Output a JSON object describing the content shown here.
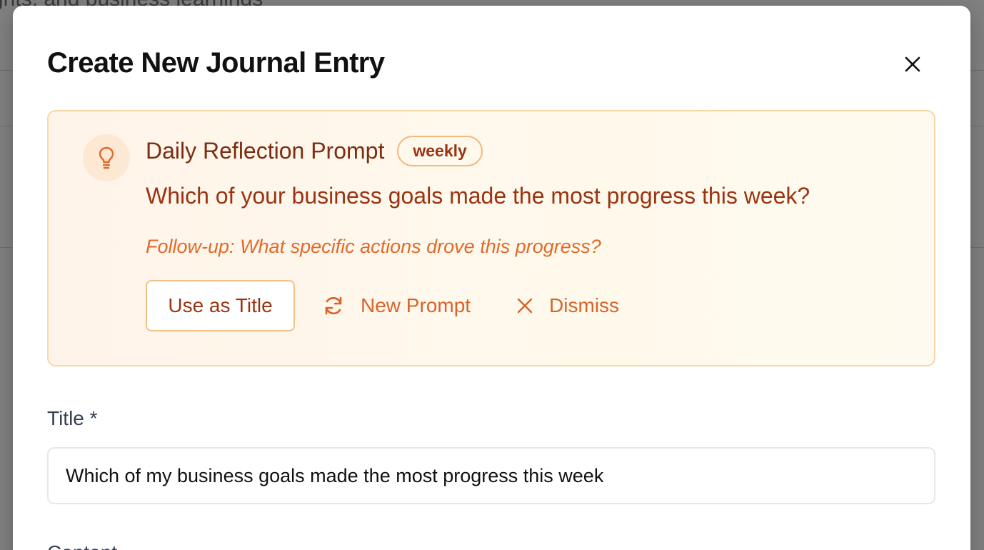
{
  "background": {
    "partial_text": "ghts, and business learnings"
  },
  "modal": {
    "title": "Create New Journal Entry",
    "close_icon": "close-icon"
  },
  "prompt": {
    "heading": "Daily Reflection Prompt",
    "badge": "weekly",
    "question": "Which of your business goals made the most progress this week?",
    "followup": "Follow-up: What specific actions drove this progress?",
    "icon": "lightbulb-icon",
    "actions": {
      "use_as_title": "Use as Title",
      "new_prompt": "New Prompt",
      "dismiss": "Dismiss"
    }
  },
  "form": {
    "title_label": "Title *",
    "title_value": "Which of my business goals made the most progress this week",
    "next_label_partial": "Content"
  },
  "colors": {
    "accent": "#d9632a",
    "prompt_text": "#9a3412",
    "card_bg": "#fff8ec",
    "card_border": "#f7d7a4"
  }
}
